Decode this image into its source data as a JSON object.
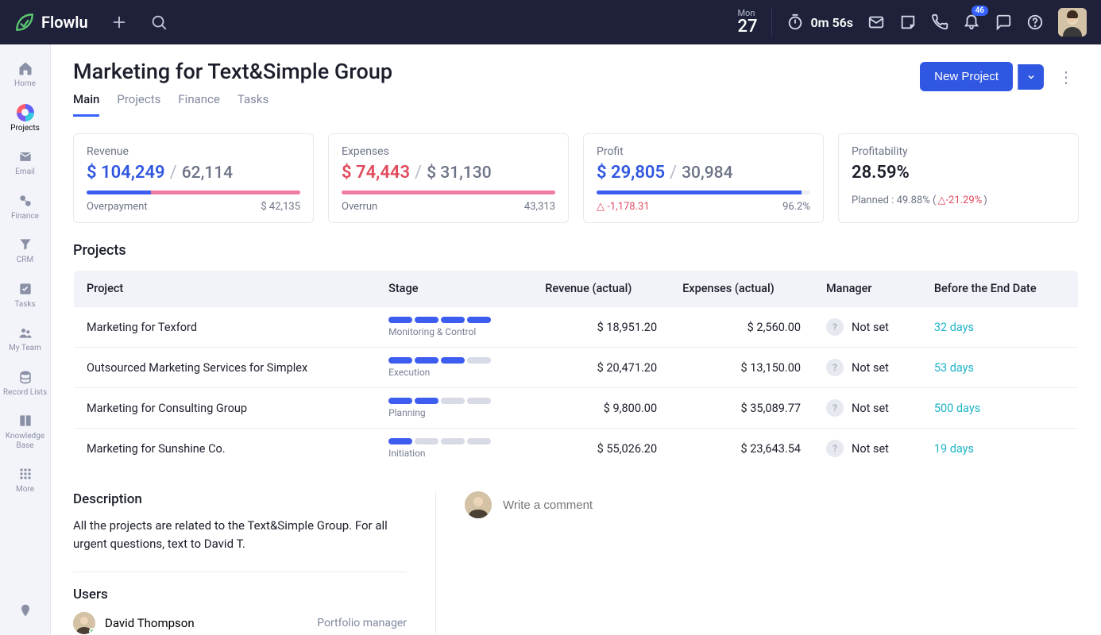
{
  "brand": "Flowlu",
  "header": {
    "day_name": "Mon",
    "day_num": "27",
    "timer": "0m 56s",
    "notif_count": "46"
  },
  "sidebar": {
    "items": [
      {
        "label": "Home"
      },
      {
        "label": "Projects"
      },
      {
        "label": "Email"
      },
      {
        "label": "Finance"
      },
      {
        "label": "CRM"
      },
      {
        "label": "Tasks"
      },
      {
        "label": "My Team"
      },
      {
        "label": "Record Lists"
      },
      {
        "label": "Knowledge Base"
      },
      {
        "label": "More"
      }
    ]
  },
  "page": {
    "title": "Marketing for Text&Simple Group",
    "tabs": [
      "Main",
      "Projects",
      "Finance",
      "Tasks"
    ],
    "new_project_label": "New Project"
  },
  "metrics": {
    "revenue": {
      "label": "Revenue",
      "primary": "$ 104,249",
      "secondary": "62,114",
      "foot_left": "Overpayment",
      "foot_right": "$ 42,135"
    },
    "expenses": {
      "label": "Expenses",
      "primary": "$ 74,443",
      "secondary": "$ 31,130",
      "foot_left": "Overrun",
      "foot_right": "43,313"
    },
    "profit": {
      "label": "Profit",
      "primary": "$ 29,805",
      "secondary": "30,984",
      "foot_left": "-1,178.31",
      "foot_right": "96.2%"
    },
    "profitability": {
      "label": "Profitability",
      "primary": "28.59%",
      "foot": "Planned : 49.88% (",
      "delta": "-21.29%",
      "foot_close": ")"
    }
  },
  "projects_heading": "Projects",
  "projects_table": {
    "cols": [
      "Project",
      "Stage",
      "Revenue (actual)",
      "Expenses (actual)",
      "Manager",
      "Before the End Date"
    ],
    "rows": [
      {
        "name": "Marketing for Texford",
        "stage_label": "Monitoring & Control",
        "stage_on": 4,
        "revenue": "$ 18,951.20",
        "expenses": "$ 2,560.00",
        "manager": "Not set",
        "days": "32 days"
      },
      {
        "name": "Outsourced Marketing Services for Simplex",
        "stage_label": "Execution",
        "stage_on": 3,
        "revenue": "$ 20,471.20",
        "expenses": "$ 13,150.00",
        "manager": "Not set",
        "days": "53 days"
      },
      {
        "name": "Marketing for Consulting Group",
        "stage_label": "Planning",
        "stage_on": 2,
        "revenue": "$ 9,800.00",
        "expenses": "$ 35,089.77",
        "manager": "Not set",
        "days": "500 days"
      },
      {
        "name": "Marketing for Sunshine Co.",
        "stage_label": "Initiation",
        "stage_on": 1,
        "revenue": "$ 55,026.20",
        "expenses": "$ 23,643.54",
        "manager": "Not set",
        "days": "19 days"
      }
    ]
  },
  "description": {
    "heading": "Description",
    "body": "All the projects are related to the Text&Simple Group. For all urgent questions, text to David T."
  },
  "users": {
    "heading": "Users",
    "rows": [
      {
        "name": "David Thompson",
        "role": "Portfolio manager"
      }
    ]
  },
  "comment_placeholder": "Write a comment"
}
